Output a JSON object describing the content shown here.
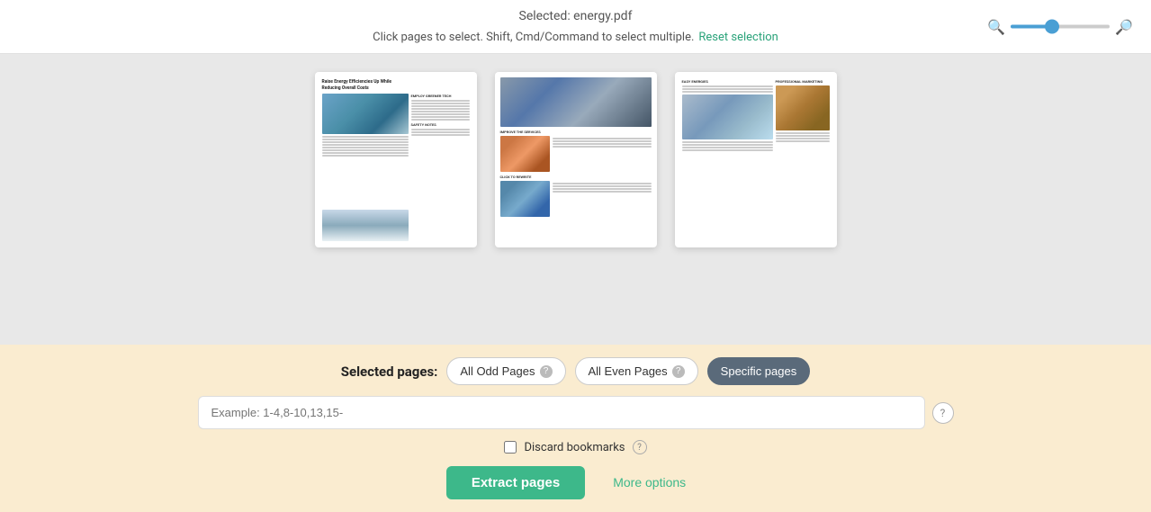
{
  "header": {
    "selected_file": "Selected: energy.pdf",
    "instruction_text": "Click pages to select. Shift, Cmd/Command to select multiple.",
    "reset_label": "Reset selection"
  },
  "zoom": {
    "value": 40
  },
  "pages": [
    {
      "id": 1
    },
    {
      "id": 2
    },
    {
      "id": 3
    }
  ],
  "bottom": {
    "selected_pages_label": "Selected pages:",
    "btn_odd": "All Odd Pages",
    "btn_even": "All Even Pages",
    "btn_specific": "Specific pages",
    "input_placeholder": "Example: 1-4,8-10,13,15-",
    "discard_label": "Discard bookmarks",
    "extract_label": "Extract pages",
    "more_options_label": "More options"
  }
}
